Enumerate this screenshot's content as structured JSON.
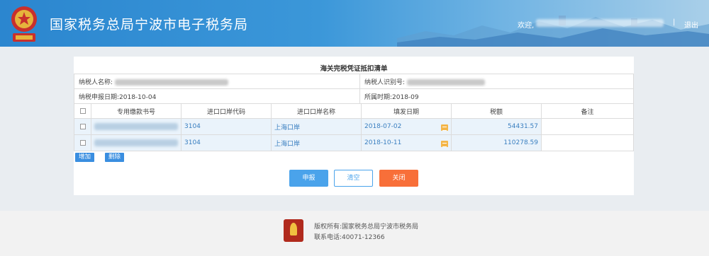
{
  "header": {
    "title": "国家税务总局宁波市电子税务局",
    "welcome": "欢迎,",
    "separator": "|",
    "logout": "退出",
    "colors": {
      "primary": "#2b86cf"
    }
  },
  "form": {
    "title": "海关完税凭证抵扣清单",
    "taxpayer_name_label": "纳税人名称:",
    "taxpayer_id_label": "纳税人识别号:",
    "report_date": "纳税申报日期:2018-10-04",
    "period": "所属时期:2018-09"
  },
  "table": {
    "headers": [
      "专用缴款书号",
      "进口口岸代码",
      "进口口岸名称",
      "填发日期",
      "税额",
      "备注"
    ],
    "rows": [
      {
        "code": "3104",
        "port": "上海口岸",
        "date": "2018-07-02",
        "tax": "54431.57",
        "remark": ""
      },
      {
        "code": "3104",
        "port": "上海口岸",
        "date": "2018-10-11",
        "tax": "110278.59",
        "remark": ""
      }
    ]
  },
  "actions": {
    "add": "增加",
    "delete": "删除",
    "submit": "申报",
    "clear": "清空",
    "close": "关闭"
  },
  "footer": {
    "copyright": "版权所有:国家税务总局宁波市税务局",
    "phone": "联系电话:40071-12366"
  }
}
